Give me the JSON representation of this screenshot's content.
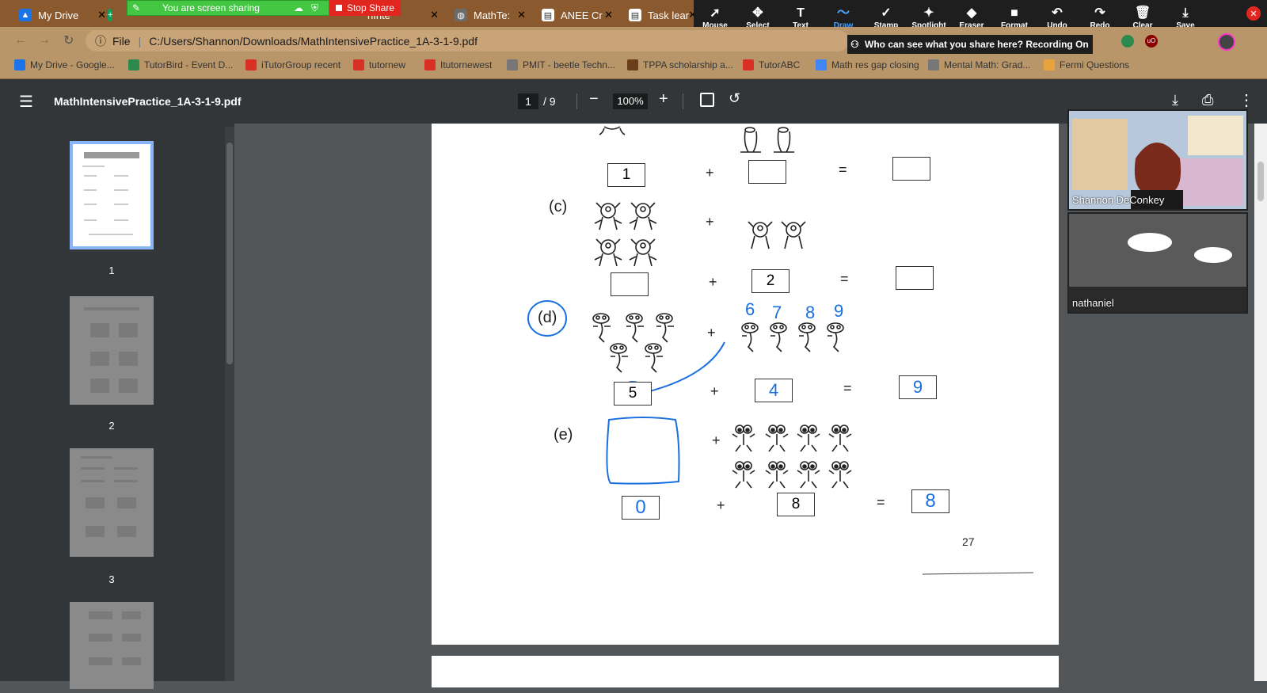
{
  "tabs": [
    {
      "label": "My Drive",
      "icon": "google-drive-icon"
    },
    {
      "label": "",
      "icon": "google-sheets-icon"
    },
    {
      "label": "",
      "icon": "google-docs-icon"
    },
    {
      "label": "hInte",
      "icon": "document-icon"
    },
    {
      "label": "MathTe:",
      "icon": "globe-icon"
    },
    {
      "label": "ANEE Cr",
      "icon": "document-icon"
    },
    {
      "label": "Task lear",
      "icon": "document-icon"
    }
  ],
  "share": {
    "banner": "You are screen sharing",
    "stop": "Stop Share"
  },
  "draw_toolbar": [
    {
      "label": "Mouse",
      "icon": "cursor-icon",
      "glyph": "➚"
    },
    {
      "label": "Select",
      "icon": "move-icon",
      "glyph": "✥"
    },
    {
      "label": "Text",
      "icon": "text-icon",
      "glyph": "T"
    },
    {
      "label": "Draw",
      "icon": "draw-icon",
      "glyph": "〜"
    },
    {
      "label": "Stamp",
      "icon": "stamp-icon",
      "glyph": "✓"
    },
    {
      "label": "Spotlight",
      "icon": "spotlight-icon",
      "glyph": "✦"
    },
    {
      "label": "Eraser",
      "icon": "eraser-icon",
      "glyph": "◆"
    },
    {
      "label": "Format",
      "icon": "format-icon",
      "glyph": "■"
    },
    {
      "label": "Undo",
      "icon": "undo-icon",
      "glyph": "↶"
    },
    {
      "label": "Redo",
      "icon": "redo-icon",
      "glyph": "↷"
    },
    {
      "label": "Clear",
      "icon": "trash-icon",
      "glyph": "🗑"
    },
    {
      "label": "Save",
      "icon": "save-icon",
      "glyph": "⤓"
    }
  ],
  "address": {
    "scheme": "File",
    "url": "C:/Users/Shannon/Downloads/MathIntensivePractice_1A-3-1-9.pdf"
  },
  "recording": "Who can see what you share here? Recording On",
  "bookmarks": [
    {
      "label": "My Drive - Google...",
      "icon": "google-drive-icon",
      "color": "#1a73e8"
    },
    {
      "label": "TutorBird - Event D...",
      "icon": "tutorbird-icon",
      "color": "#2d8a4e"
    },
    {
      "label": "iTutorGroup recent",
      "icon": "itutor-icon",
      "color": "#d93025"
    },
    {
      "label": "tutornew",
      "icon": "itutor-icon",
      "color": "#d93025"
    },
    {
      "label": "Itutornewest",
      "icon": "itutor-icon",
      "color": "#d93025"
    },
    {
      "label": "PMIT - beetle Techn...",
      "icon": "globe-icon",
      "color": "#777777"
    },
    {
      "label": "TPPA scholarship a...",
      "icon": "owl-icon",
      "color": "#6b3d1a"
    },
    {
      "label": "TutorABC",
      "icon": "itutor-icon",
      "color": "#d93025"
    },
    {
      "label": "Math res gap closing",
      "icon": "globe-icon",
      "color": "#4285f4"
    },
    {
      "label": "Mental Math: Grad...",
      "icon": "globe-icon",
      "color": "#777777"
    },
    {
      "label": "Fermi Questions",
      "icon": "fermi-icon",
      "color": "#e8a33d"
    }
  ],
  "pdf": {
    "filename": "MathIntensivePractice_1A-3-1-9.pdf",
    "page": "1",
    "total": "/ 9",
    "zoom": "100%"
  },
  "thumbs": [
    "1",
    "2",
    "3"
  ],
  "worksheet": {
    "row_b": {
      "a": "1",
      "plus": "+",
      "b": "",
      "eq": "=",
      "r": ""
    },
    "row_c": {
      "label": "(c)",
      "a": "",
      "plus": "+",
      "b": "2",
      "eq": "=",
      "r": ""
    },
    "row_d": {
      "label": "(d)",
      "a": "5",
      "plus": "+",
      "b": "4",
      "eq": "=",
      "r": "9",
      "counts": [
        "6",
        "7",
        "8",
        "9"
      ]
    },
    "row_e": {
      "label": "(e)",
      "a": "0",
      "plus": "+",
      "b": "8",
      "eq": "=",
      "r": "8"
    },
    "page_number": "27"
  },
  "participants": [
    {
      "name": "Shannon DeConkey"
    },
    {
      "name": "nathaniel"
    }
  ]
}
